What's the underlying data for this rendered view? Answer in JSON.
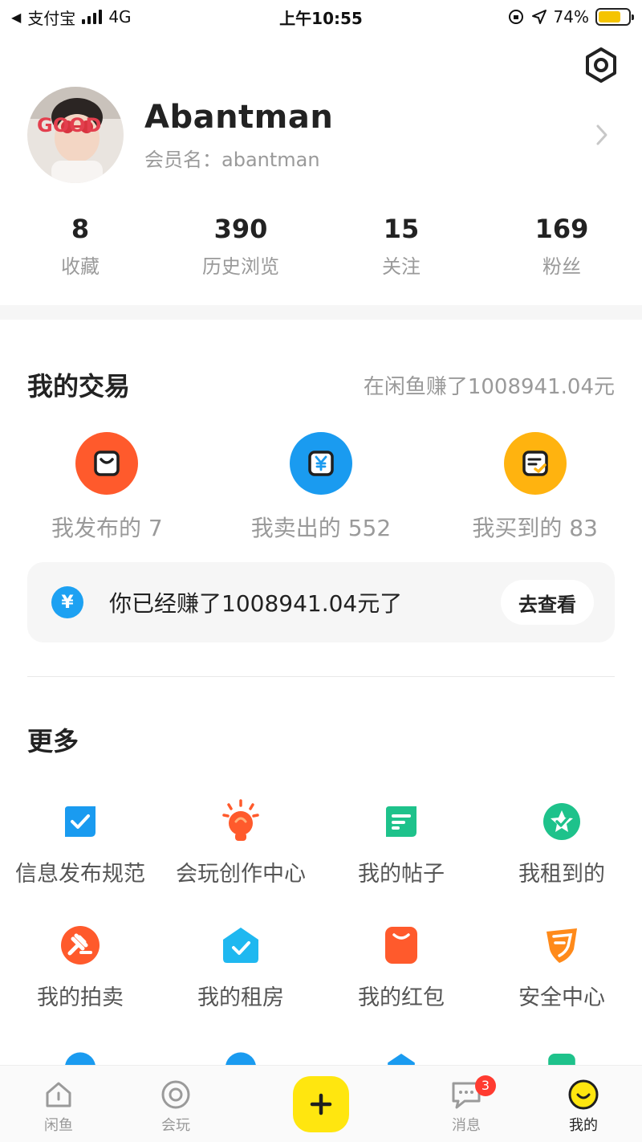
{
  "status_bar": {
    "back_app": "支付宝",
    "network": "4G",
    "time": "上午10:55",
    "battery_percent": "74%",
    "battery_level": 0.74
  },
  "profile": {
    "name": "Abantman",
    "member_label": "会员名：",
    "member_id": "abantman",
    "avatar_text": "GOOD"
  },
  "stats": [
    {
      "value": "8",
      "label": "收藏"
    },
    {
      "value": "390",
      "label": "历史浏览"
    },
    {
      "value": "15",
      "label": "关注"
    },
    {
      "value": "169",
      "label": "粉丝"
    }
  ],
  "trade": {
    "title": "我的交易",
    "summary": "在闲鱼赚了1008941.04元",
    "items": [
      {
        "label": "我发布的 7",
        "color": "#ff5a2c",
        "icon": "bag-icon"
      },
      {
        "label": "我卖出的 552",
        "color": "#1a9bf0",
        "icon": "yen-icon"
      },
      {
        "label": "我买到的 83",
        "color": "#ffb30f",
        "icon": "order-icon"
      }
    ],
    "banner_text": "你已经赚了1008941.04元了",
    "banner_coin": "¥",
    "banner_button": "去查看"
  },
  "more": {
    "title": "更多",
    "items": [
      {
        "label": "信息发布规范",
        "icon": "checklist-icon",
        "color": "#1a9bf0"
      },
      {
        "label": "会玩创作中心",
        "icon": "lightbulb-icon",
        "color": "#ff5a2c"
      },
      {
        "label": "我的帖子",
        "icon": "post-icon",
        "color": "#1ec28b"
      },
      {
        "label": "我租到的",
        "icon": "rent-star-icon",
        "color": "#1ec28b"
      },
      {
        "label": "我的拍卖",
        "icon": "auction-hammer-icon",
        "color": "#ff5a2c"
      },
      {
        "label": "我的租房",
        "icon": "house-icon",
        "color": "#1fb8f0"
      },
      {
        "label": "我的红包",
        "icon": "red-packet-icon",
        "color": "#ff5a2c"
      },
      {
        "label": "安全中心",
        "icon": "shield-icon",
        "color": "#ff8a1a"
      }
    ]
  },
  "tab_bar": {
    "tabs": [
      {
        "label": "闲鱼",
        "icon": "home-icon"
      },
      {
        "label": "会玩",
        "icon": "play-circle-icon"
      },
      {
        "label": "消息",
        "icon": "message-icon",
        "badge": "3"
      },
      {
        "label": "我的",
        "icon": "smile-face-icon"
      }
    ],
    "publish_icon": "plus-icon"
  }
}
